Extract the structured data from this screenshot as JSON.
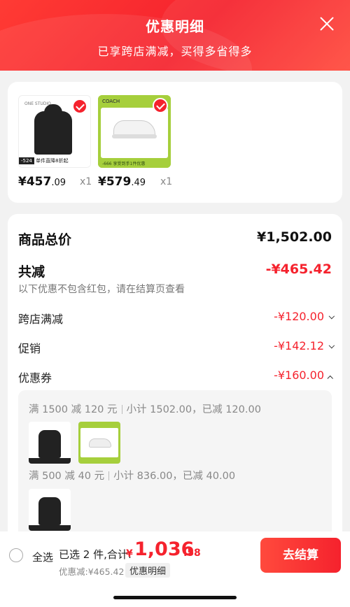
{
  "header": {
    "title": "优惠明细",
    "subtitle": "已享跨店满减，买得多省得多"
  },
  "products": [
    {
      "price_int": "¥457",
      "price_dec": ".09",
      "qty": "x1",
      "brand": "ONE STUDIO",
      "badge_price": "-524",
      "badge_text": "单件直降8折起"
    },
    {
      "price_int": "¥579",
      "price_dec": ".49",
      "qty": "x1",
      "brand": "COACH",
      "badge_price": "-666",
      "badge_text": "享受到手1件优惠"
    }
  ],
  "summary": {
    "total_label": "商品总价",
    "total_value": "¥1,502.00",
    "reduce_label": "共减",
    "reduce_value": "-¥465.42",
    "note": "以下优惠不包含红包，请在结算页查看",
    "items": [
      {
        "label": "跨店满减",
        "value": "-¥120.00"
      },
      {
        "label": "促销",
        "value": "-¥142.12"
      },
      {
        "label": "优惠券",
        "value": "-¥160.00"
      }
    ]
  },
  "coupon_details": [
    {
      "condition": "满 1500 减 120 元",
      "subtotal": "小计 1502.00，已减 120.00"
    },
    {
      "condition": "满 500 减 40 元",
      "subtotal": "小计 836.00，已减 40.00"
    }
  ],
  "footer": {
    "select_all": "全选",
    "selected": "已选 2 件,合计:",
    "currency": "¥",
    "total_int": "1,036",
    "total_dec": ".58",
    "discount": "优惠减:¥465.42",
    "detail_tag": "优惠明细",
    "checkout": "去结算"
  },
  "colors": {
    "accent": "#f5222d",
    "shoe_green": "#a6cf3c"
  }
}
